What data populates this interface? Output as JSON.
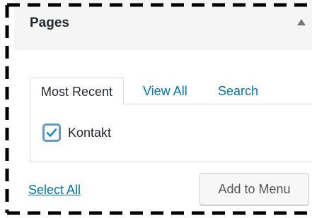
{
  "panel": {
    "title": "Pages",
    "toggle_icon": "triangle-up-icon"
  },
  "tabs": [
    {
      "label": "Most Recent",
      "active": true
    },
    {
      "label": "View All",
      "active": false
    },
    {
      "label": "Search",
      "active": false
    }
  ],
  "items": [
    {
      "label": "Kontakt",
      "checked": true
    }
  ],
  "footer": {
    "select_all": "Select All",
    "add_button": "Add to Menu"
  },
  "colors": {
    "link": "#0073aa",
    "text": "#23282d",
    "header_bg": "#f5f5f5",
    "focus_ring": "#5b9dd9"
  }
}
